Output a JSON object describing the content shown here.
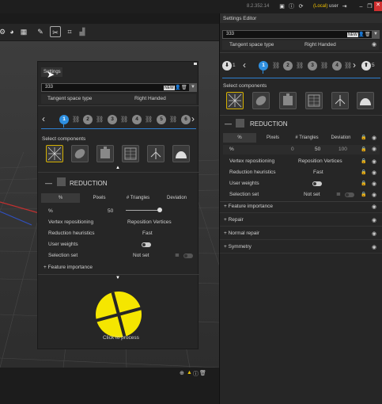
{
  "titlebar": {
    "version": "8.2.352.14",
    "user_prefix": "(Local)",
    "user_name": "user"
  },
  "viewport_toolbar": {
    "icons": [
      "settings-icon",
      "globe-icon",
      "grid-icon",
      "brush-icon",
      "scissors-icon",
      "hierarchy-icon",
      "chart-icon"
    ]
  },
  "floating_panel": {
    "tab_label": "Settings",
    "search_value": "333",
    "tangent_label": "Tangent space type",
    "tangent_value": "Right Handed",
    "steps": [
      "1",
      "2",
      "3",
      "4",
      "5",
      "6"
    ],
    "select_components_label": "Select components",
    "section_title": "REDUCTION",
    "tabs": [
      "%",
      "Pixels",
      "# Triangles",
      "Deviation"
    ],
    "percent_label": "%",
    "percent_value": "50",
    "vertex_label": "Vertex repositioning",
    "vertex_value": "Reposition Vertices",
    "heuristics_label": "Reduction heuristics",
    "heuristics_value": "Fast",
    "user_weights_label": "User weights",
    "selection_set_label": "Selection set",
    "selection_set_value": "Not set",
    "feature_label": "Feature importance",
    "process_label": "Click to process"
  },
  "settings_editor": {
    "title": "Settings Editor",
    "search_value": "333",
    "tangent_label": "Tangent space type",
    "tangent_value": "Right Handed",
    "steps": [
      "1",
      "2",
      "3",
      "4",
      "5"
    ],
    "select_components_label": "Select components",
    "section_title": "REDUCTION",
    "tabs": [
      "%",
      "Pixels",
      "# Triangles",
      "Deviation"
    ],
    "percent_label": "%",
    "percent_low": "0",
    "percent_value": "50",
    "percent_high": "100",
    "vertex_label": "Vertex repositioning",
    "vertex_value": "Reposition Vertices",
    "heuristics_label": "Reduction heuristics",
    "heuristics_value": "Fast",
    "user_weights_label": "User weights",
    "selection_set_label": "Selection set",
    "selection_set_value": "Not set",
    "collapsed_sections": [
      "Feature importance",
      "Repair",
      "Normal repair",
      "Symmetry"
    ]
  },
  "colors": {
    "accent_blue": "#2e8fe0",
    "highlight_yellow": "#f5e600",
    "close_red": "#d03030",
    "user_yellow": "#f0c000"
  }
}
